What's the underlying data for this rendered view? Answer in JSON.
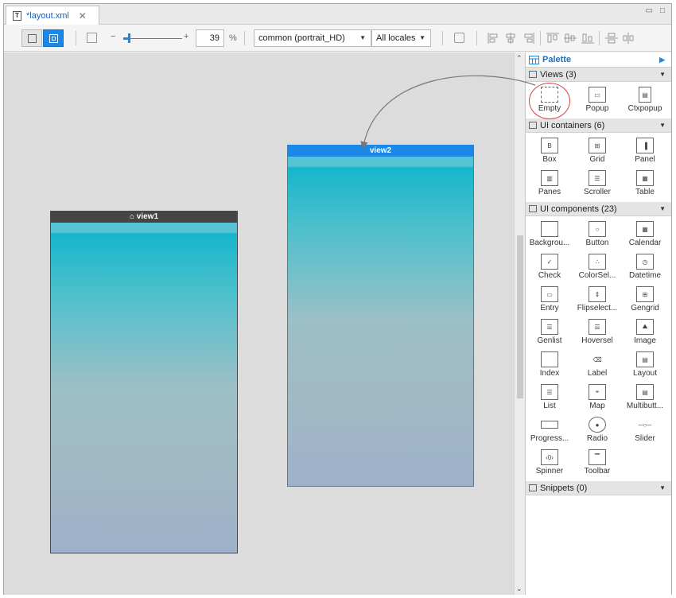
{
  "tab": {
    "label": "*layout.xml",
    "icon": "T"
  },
  "toolbar": {
    "zoom_minus": "−",
    "zoom_plus": "+",
    "zoom_value": "39",
    "zoom_unit": "%",
    "zoom_slider_fraction": 0.1,
    "profile": "common (portrait_HD)",
    "locale": "All locales"
  },
  "canvas": {
    "views": [
      {
        "title": "view1",
        "marker": "⌂"
      },
      {
        "title": "view2"
      }
    ]
  },
  "palette": {
    "title": "Palette",
    "sections": [
      {
        "title": "Views (3)",
        "items": [
          "Empty",
          "Popup",
          "Ctxpopup"
        ]
      },
      {
        "title": "UI containers (6)",
        "items": [
          "Box",
          "Grid",
          "Panel",
          "Panes",
          "Scroller",
          "Table"
        ]
      },
      {
        "title": "UI components (23)",
        "items": [
          "Backgrou...",
          "Button",
          "Calendar",
          "Check",
          "ColorSel...",
          "Datetime",
          "Entry",
          "Flipselect...",
          "Gengrid",
          "Genlist",
          "Hoversel",
          "Image",
          "Index",
          "Label",
          "Layout",
          "List",
          "Map",
          "Multibutt...",
          "Progress...",
          "Radio",
          "Slider",
          "Spinner",
          "Toolbar"
        ]
      },
      {
        "title": "Snippets (0)",
        "items": []
      }
    ]
  },
  "colors": {
    "accent": "#1b87e6",
    "view_header_dark": "#454545",
    "highlight": "#d94040"
  }
}
